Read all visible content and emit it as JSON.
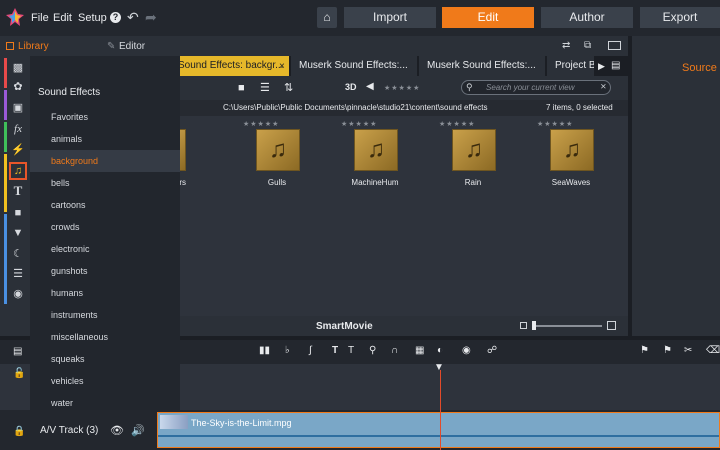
{
  "menu": {
    "file": "File",
    "edit": "Edit",
    "setup": "Setup",
    "help": "?"
  },
  "modes": {
    "import": "Import",
    "edit": "Edit",
    "author": "Author",
    "export": "Export"
  },
  "library": {
    "library_tab": "Library",
    "editor_tab": "Editor"
  },
  "source_label": "Source",
  "categories": {
    "title": "Sound Effects",
    "items": [
      "Favorites",
      "animals",
      "background",
      "bells",
      "cartoons",
      "crowds",
      "electronic",
      "gunshots",
      "humans",
      "instruments",
      "miscellaneous",
      "squeaks",
      "vehicles",
      "water"
    ],
    "selected": "background"
  },
  "tabs": [
    "Sound Effects: backgr...",
    "Muserk Sound Effects:...",
    "Muserk Sound Effects:...",
    "Project B"
  ],
  "toolbar": {
    "view3d": "3D",
    "search_placeholder": "Search your current view"
  },
  "path": "C:\\Users\\Public\\Public Documents\\pinnacle\\studio21\\content\\sound effects",
  "item_count": "7 items, 0 selected",
  "items": [
    {
      "label": "ers"
    },
    {
      "label": "Gulls"
    },
    {
      "label": "MachineHum"
    },
    {
      "label": "Rain"
    },
    {
      "label": "SeaWaves"
    }
  ],
  "smartmovie": "SmartMovie",
  "track": {
    "label": "A/V Track (3)",
    "clip": "The-Sky-is-the-Limit.mpg"
  },
  "colors": {
    "accent": "#f07a1a",
    "tab_active": "#e6b82a"
  }
}
